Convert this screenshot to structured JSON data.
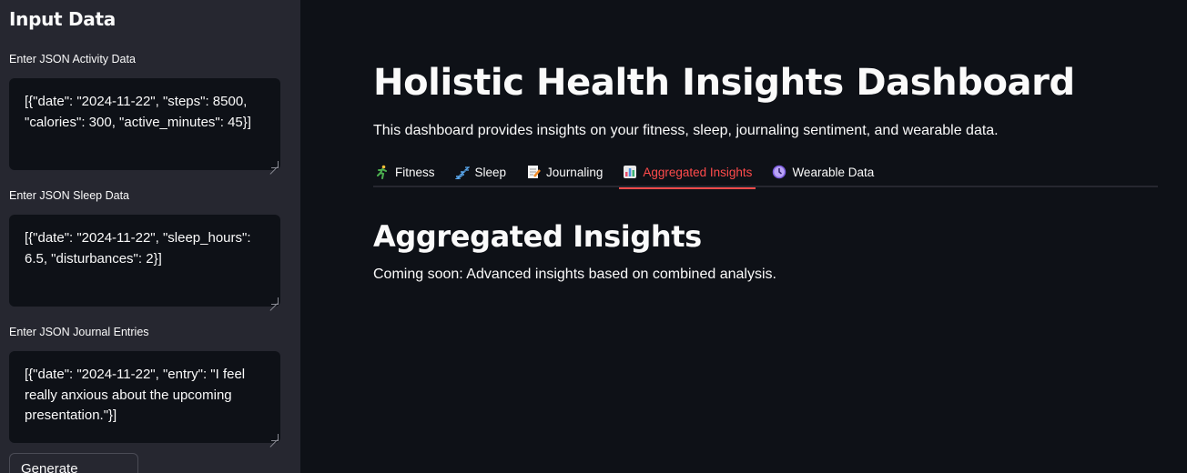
{
  "sidebar": {
    "title": "Input Data",
    "fields": [
      {
        "label": "Enter JSON Activity Data",
        "value": "[{\"date\": \"2024-11-22\", \"steps\": 8500, \"calories\": 300, \"active_minutes\": 45}]"
      },
      {
        "label": "Enter JSON Sleep Data",
        "value": "[{\"date\": \"2024-11-22\", \"sleep_hours\": 6.5, \"disturbances\": 2}]"
      },
      {
        "label": "Enter JSON Journal Entries",
        "value": "[{\"date\": \"2024-11-22\", \"entry\": \"I feel really anxious about the upcoming presentation.\"}]"
      }
    ],
    "generate_button": "Generate Insights"
  },
  "main": {
    "title": "Holistic Health Insights Dashboard",
    "description": "This dashboard provides insights on your fitness, sleep, journaling sentiment, and wearable data.",
    "tabs": [
      {
        "label": "Fitness",
        "icon": "runner-icon",
        "active": false
      },
      {
        "label": "Sleep",
        "icon": "sleep-icon",
        "active": false
      },
      {
        "label": "Journaling",
        "icon": "memo-icon",
        "active": false
      },
      {
        "label": "Aggregated Insights",
        "icon": "bar-chart-icon",
        "active": true
      },
      {
        "label": "Wearable Data",
        "icon": "watch-icon",
        "active": false
      }
    ],
    "section_title": "Aggregated Insights",
    "section_text": "Coming soon: Advanced insights based on combined analysis."
  },
  "colors": {
    "background": "#0e1117",
    "sidebar": "#262730",
    "accent": "#ff4b4b",
    "text": "#fafafa"
  }
}
